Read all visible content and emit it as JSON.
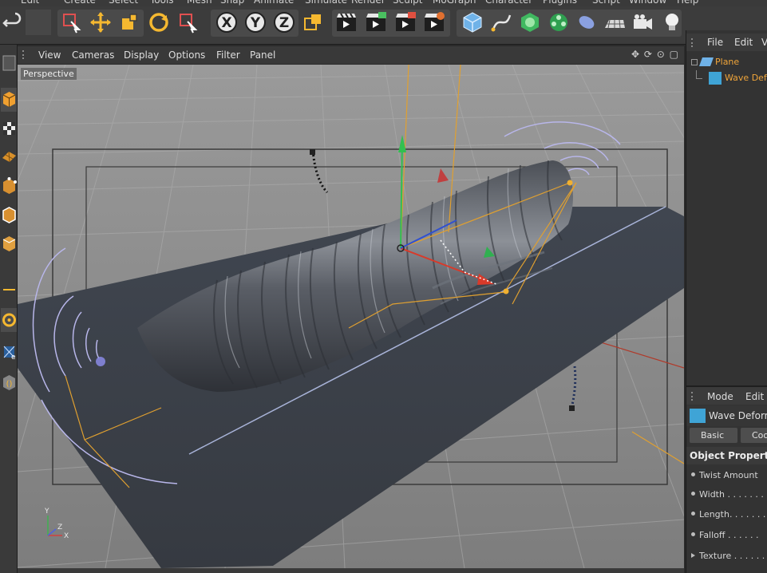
{
  "menubar": {
    "items": [
      "Edit",
      "Create",
      "Select",
      "Tools",
      "Mesh",
      "Snap",
      "Animate",
      "Simulate",
      "Render",
      "Sculpt",
      "MoGraph",
      "Character",
      "Plugins",
      "Script",
      "Window",
      "Help"
    ]
  },
  "toolbar": {
    "axis_x": "X",
    "axis_y": "Y",
    "axis_z": "Z"
  },
  "viewport": {
    "menu": [
      "View",
      "Cameras",
      "Display",
      "Options",
      "Filter",
      "Panel"
    ],
    "nav_icons": "✥ ⟳ ⊙ ▢",
    "label": "Perspective",
    "axis_y": "Y",
    "axis_x": "X",
    "axis_z": "Z"
  },
  "object_manager": {
    "menu": [
      "File",
      "Edit",
      "Vi"
    ],
    "objects": [
      {
        "name": "Plane",
        "icon": "plane-object-icon"
      },
      {
        "name": "Wave Deformer",
        "icon": "wave-deformer-icon"
      }
    ]
  },
  "attribute_manager": {
    "menu": [
      "Mode",
      "Edit"
    ],
    "object_name": "Wave Deformer",
    "tabs": [
      "Basic",
      "Coord."
    ],
    "section_title": "Object Properties",
    "properties": [
      "Twist Amount",
      "Width . . . . . . .",
      "Length. . . . . . .",
      "Falloff . . . . . .",
      "Texture . . . . . ."
    ]
  },
  "colors": {
    "viewport_bg": "#8b8b8b",
    "object_active": "#f0a53a",
    "plane_surface": "#3b3f47",
    "accent_blue": "#5f8fd6"
  }
}
